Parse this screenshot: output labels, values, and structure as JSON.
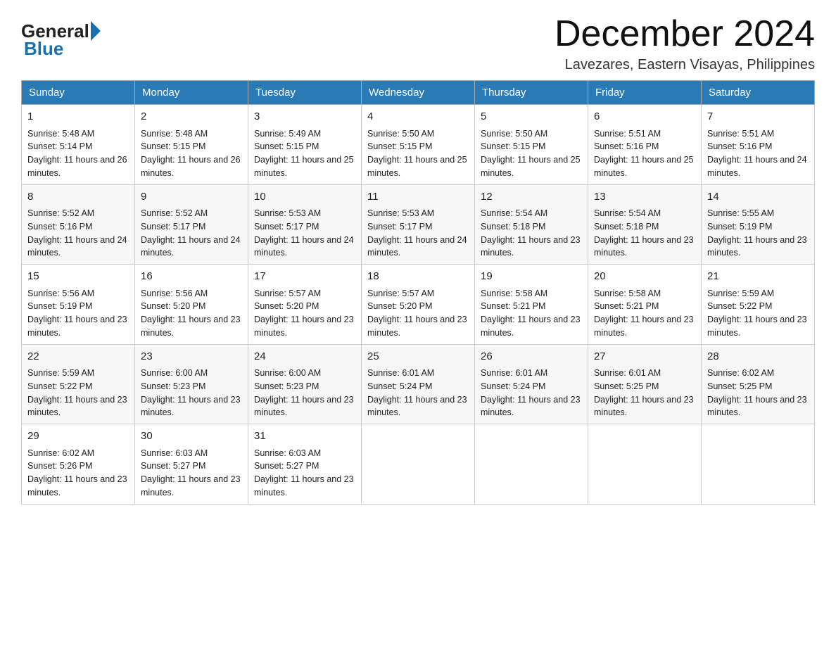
{
  "header": {
    "logo_general": "General",
    "logo_blue": "Blue",
    "month_title": "December 2024",
    "location": "Lavezares, Eastern Visayas, Philippines"
  },
  "days_of_week": [
    "Sunday",
    "Monday",
    "Tuesday",
    "Wednesday",
    "Thursday",
    "Friday",
    "Saturday"
  ],
  "weeks": [
    [
      {
        "day": "1",
        "sunrise": "Sunrise: 5:48 AM",
        "sunset": "Sunset: 5:14 PM",
        "daylight": "Daylight: 11 hours and 26 minutes."
      },
      {
        "day": "2",
        "sunrise": "Sunrise: 5:48 AM",
        "sunset": "Sunset: 5:15 PM",
        "daylight": "Daylight: 11 hours and 26 minutes."
      },
      {
        "day": "3",
        "sunrise": "Sunrise: 5:49 AM",
        "sunset": "Sunset: 5:15 PM",
        "daylight": "Daylight: 11 hours and 25 minutes."
      },
      {
        "day": "4",
        "sunrise": "Sunrise: 5:50 AM",
        "sunset": "Sunset: 5:15 PM",
        "daylight": "Daylight: 11 hours and 25 minutes."
      },
      {
        "day": "5",
        "sunrise": "Sunrise: 5:50 AM",
        "sunset": "Sunset: 5:15 PM",
        "daylight": "Daylight: 11 hours and 25 minutes."
      },
      {
        "day": "6",
        "sunrise": "Sunrise: 5:51 AM",
        "sunset": "Sunset: 5:16 PM",
        "daylight": "Daylight: 11 hours and 25 minutes."
      },
      {
        "day": "7",
        "sunrise": "Sunrise: 5:51 AM",
        "sunset": "Sunset: 5:16 PM",
        "daylight": "Daylight: 11 hours and 24 minutes."
      }
    ],
    [
      {
        "day": "8",
        "sunrise": "Sunrise: 5:52 AM",
        "sunset": "Sunset: 5:16 PM",
        "daylight": "Daylight: 11 hours and 24 minutes."
      },
      {
        "day": "9",
        "sunrise": "Sunrise: 5:52 AM",
        "sunset": "Sunset: 5:17 PM",
        "daylight": "Daylight: 11 hours and 24 minutes."
      },
      {
        "day": "10",
        "sunrise": "Sunrise: 5:53 AM",
        "sunset": "Sunset: 5:17 PM",
        "daylight": "Daylight: 11 hours and 24 minutes."
      },
      {
        "day": "11",
        "sunrise": "Sunrise: 5:53 AM",
        "sunset": "Sunset: 5:17 PM",
        "daylight": "Daylight: 11 hours and 24 minutes."
      },
      {
        "day": "12",
        "sunrise": "Sunrise: 5:54 AM",
        "sunset": "Sunset: 5:18 PM",
        "daylight": "Daylight: 11 hours and 23 minutes."
      },
      {
        "day": "13",
        "sunrise": "Sunrise: 5:54 AM",
        "sunset": "Sunset: 5:18 PM",
        "daylight": "Daylight: 11 hours and 23 minutes."
      },
      {
        "day": "14",
        "sunrise": "Sunrise: 5:55 AM",
        "sunset": "Sunset: 5:19 PM",
        "daylight": "Daylight: 11 hours and 23 minutes."
      }
    ],
    [
      {
        "day": "15",
        "sunrise": "Sunrise: 5:56 AM",
        "sunset": "Sunset: 5:19 PM",
        "daylight": "Daylight: 11 hours and 23 minutes."
      },
      {
        "day": "16",
        "sunrise": "Sunrise: 5:56 AM",
        "sunset": "Sunset: 5:20 PM",
        "daylight": "Daylight: 11 hours and 23 minutes."
      },
      {
        "day": "17",
        "sunrise": "Sunrise: 5:57 AM",
        "sunset": "Sunset: 5:20 PM",
        "daylight": "Daylight: 11 hours and 23 minutes."
      },
      {
        "day": "18",
        "sunrise": "Sunrise: 5:57 AM",
        "sunset": "Sunset: 5:20 PM",
        "daylight": "Daylight: 11 hours and 23 minutes."
      },
      {
        "day": "19",
        "sunrise": "Sunrise: 5:58 AM",
        "sunset": "Sunset: 5:21 PM",
        "daylight": "Daylight: 11 hours and 23 minutes."
      },
      {
        "day": "20",
        "sunrise": "Sunrise: 5:58 AM",
        "sunset": "Sunset: 5:21 PM",
        "daylight": "Daylight: 11 hours and 23 minutes."
      },
      {
        "day": "21",
        "sunrise": "Sunrise: 5:59 AM",
        "sunset": "Sunset: 5:22 PM",
        "daylight": "Daylight: 11 hours and 23 minutes."
      }
    ],
    [
      {
        "day": "22",
        "sunrise": "Sunrise: 5:59 AM",
        "sunset": "Sunset: 5:22 PM",
        "daylight": "Daylight: 11 hours and 23 minutes."
      },
      {
        "day": "23",
        "sunrise": "Sunrise: 6:00 AM",
        "sunset": "Sunset: 5:23 PM",
        "daylight": "Daylight: 11 hours and 23 minutes."
      },
      {
        "day": "24",
        "sunrise": "Sunrise: 6:00 AM",
        "sunset": "Sunset: 5:23 PM",
        "daylight": "Daylight: 11 hours and 23 minutes."
      },
      {
        "day": "25",
        "sunrise": "Sunrise: 6:01 AM",
        "sunset": "Sunset: 5:24 PM",
        "daylight": "Daylight: 11 hours and 23 minutes."
      },
      {
        "day": "26",
        "sunrise": "Sunrise: 6:01 AM",
        "sunset": "Sunset: 5:24 PM",
        "daylight": "Daylight: 11 hours and 23 minutes."
      },
      {
        "day": "27",
        "sunrise": "Sunrise: 6:01 AM",
        "sunset": "Sunset: 5:25 PM",
        "daylight": "Daylight: 11 hours and 23 minutes."
      },
      {
        "day": "28",
        "sunrise": "Sunrise: 6:02 AM",
        "sunset": "Sunset: 5:25 PM",
        "daylight": "Daylight: 11 hours and 23 minutes."
      }
    ],
    [
      {
        "day": "29",
        "sunrise": "Sunrise: 6:02 AM",
        "sunset": "Sunset: 5:26 PM",
        "daylight": "Daylight: 11 hours and 23 minutes."
      },
      {
        "day": "30",
        "sunrise": "Sunrise: 6:03 AM",
        "sunset": "Sunset: 5:27 PM",
        "daylight": "Daylight: 11 hours and 23 minutes."
      },
      {
        "day": "31",
        "sunrise": "Sunrise: 6:03 AM",
        "sunset": "Sunset: 5:27 PM",
        "daylight": "Daylight: 11 hours and 23 minutes."
      },
      null,
      null,
      null,
      null
    ]
  ]
}
